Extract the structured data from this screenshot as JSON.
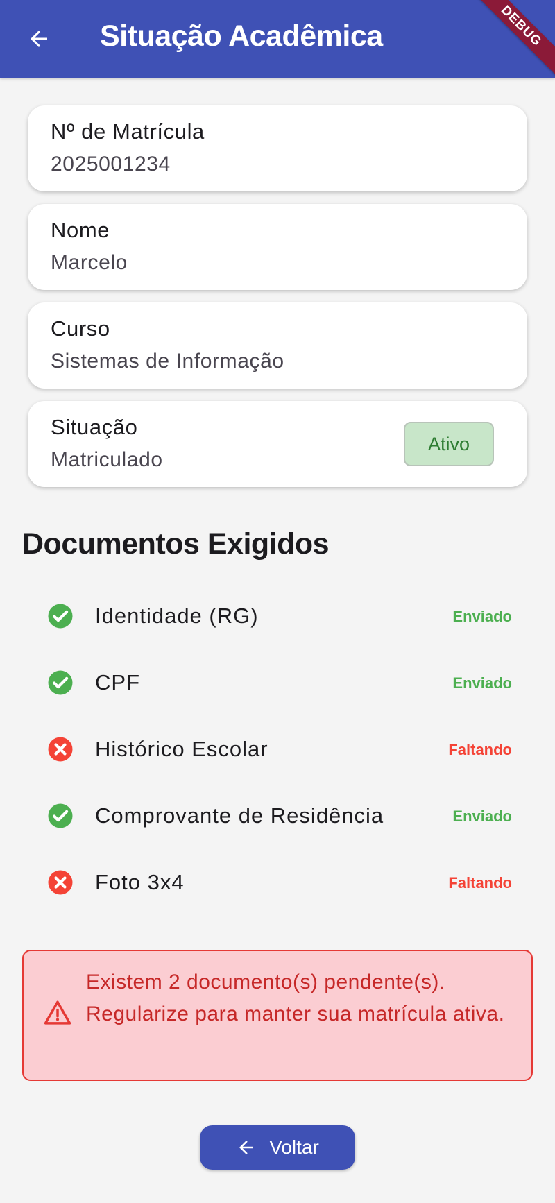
{
  "appbar": {
    "title": "Situação Acadêmica",
    "debug_label": "DEBUG",
    "background": "#3f51b5",
    "back_icon": "arrow-back-icon"
  },
  "cards": [
    {
      "label": "Nº de Matrícula",
      "value": "2025001234"
    },
    {
      "label": "Nome",
      "value": "Marcelo"
    },
    {
      "label": "Curso",
      "value": "Sistemas de Informação"
    },
    {
      "label": "Situação",
      "value": "Matriculado",
      "badge": "Ativo"
    }
  ],
  "documents": {
    "title": "Documentos Exigidos",
    "items": [
      {
        "name": "Identidade (RG)",
        "status": "Enviado",
        "icon": "check-circle-icon"
      },
      {
        "name": "CPF",
        "status": "Enviado",
        "icon": "check-circle-icon"
      },
      {
        "name": "Histórico Escolar",
        "status": "Faltando",
        "icon": "cancel-circle-icon"
      },
      {
        "name": "Comprovante de Residência",
        "status": "Enviado",
        "icon": "check-circle-icon"
      },
      {
        "name": "Foto 3x4",
        "status": "Faltando",
        "icon": "cancel-circle-icon"
      }
    ]
  },
  "alert": {
    "message": "Existem 2 documento(s) pendente(s). Regularize para manter sua matrícula ativa.",
    "icon": "warning-icon",
    "color": "#c62828"
  },
  "footer": {
    "back_label": "Voltar",
    "icon": "arrow-back-icon"
  },
  "colors": {
    "ok": "#4caf50",
    "missing": "#f44336",
    "badge_bg": "#c8e6c9",
    "badge_text": "#2e7d32"
  }
}
